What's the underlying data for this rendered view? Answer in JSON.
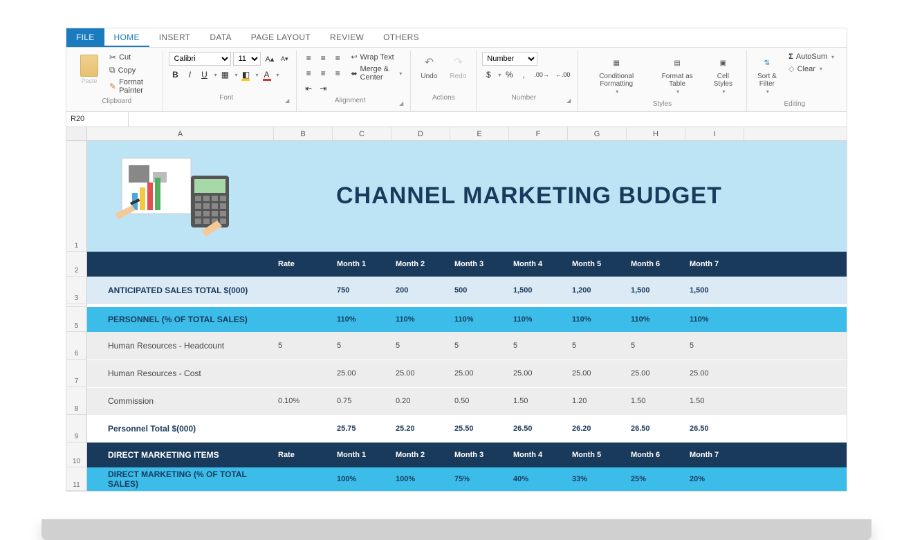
{
  "tabs": {
    "file": "FILE",
    "home": "HOME",
    "insert": "INSERT",
    "data": "DATA",
    "page_layout": "PAGE LAYOUT",
    "review": "REVIEW",
    "others": "OTHERS"
  },
  "ribbon": {
    "clipboard": {
      "label": "Clipboard",
      "cut": "Cut",
      "copy": "Copy",
      "format_painter": "Format Painter",
      "paste": "Paste"
    },
    "font": {
      "label": "Font",
      "family": "Calibri",
      "size": "11"
    },
    "alignment": {
      "label": "Alignment",
      "wrap": "Wrap Text",
      "merge": "Merge & Center"
    },
    "actions": {
      "label": "Actions",
      "undo": "Undo",
      "redo": "Redo"
    },
    "number": {
      "label": "Number",
      "format": "Number"
    },
    "styles": {
      "label": "Styles",
      "conditional": "Conditional Formatting",
      "format_as_table": "Format as Table",
      "cell_styles": "Cell Styles"
    },
    "editing": {
      "label": "Editing",
      "sort_filter": "Sort & Filter",
      "autosum": "AutoSum",
      "clear": "Clear"
    }
  },
  "name_box": "R20",
  "columns": [
    "A",
    "B",
    "C",
    "D",
    "E",
    "F",
    "G",
    "H",
    "I"
  ],
  "row_heights": {
    "banner": 160,
    "r2": 36,
    "r3": 40,
    "sep": 4,
    "r5": 36,
    "r6": 40,
    "r7": 40,
    "r8": 40,
    "r9": 40,
    "r10": 36,
    "r11": 34
  },
  "banner_title": "CHANNEL MARKETING BUDGET",
  "header_months": {
    "rate": "Rate",
    "m": [
      "Month 1",
      "Month 2",
      "Month 3",
      "Month 4",
      "Month 5",
      "Month 6",
      "Month 7"
    ]
  },
  "rows": {
    "anticipated": {
      "label": "ANTICIPATED SALES TOTAL $(000)",
      "rate": "",
      "v": [
        "750",
        "200",
        "500",
        "1,500",
        "1,200",
        "1,500",
        "1,500"
      ]
    },
    "personnel_pct": {
      "label": "PERSONNEL (% OF TOTAL SALES)",
      "rate": "",
      "v": [
        "110%",
        "110%",
        "110%",
        "110%",
        "110%",
        "110%",
        "110%"
      ]
    },
    "hr_headcount": {
      "label": "Human Resources - Headcount",
      "rate": "5",
      "v": [
        "5",
        "5",
        "5",
        "5",
        "5",
        "5",
        "5"
      ]
    },
    "hr_cost": {
      "label": "Human Resources - Cost",
      "rate": "",
      "v": [
        "25.00",
        "25.00",
        "25.00",
        "25.00",
        "25.00",
        "25.00",
        "25.00"
      ]
    },
    "commission": {
      "label": "Commission",
      "rate": "0.10%",
      "v": [
        "0.75",
        "0.20",
        "0.50",
        "1.50",
        "1.20",
        "1.50",
        "1.50"
      ]
    },
    "personnel_total": {
      "label": "Personnel Total $(000)",
      "rate": "",
      "v": [
        "25.75",
        "25.20",
        "25.50",
        "26.50",
        "26.20",
        "26.50",
        "26.50"
      ]
    },
    "direct_items": {
      "label": "DIRECT MARKETING ITEMS",
      "rate": "Rate",
      "v": [
        "Month 1",
        "Month 2",
        "Month 3",
        "Month 4",
        "Month 5",
        "Month 6",
        "Month 7"
      ]
    },
    "direct_pct": {
      "label": "DIRECT MARKETING (% OF TOTAL SALES)",
      "rate": "",
      "v": [
        "100%",
        "100%",
        "75%",
        "40%",
        "33%",
        "25%",
        "20%"
      ]
    }
  }
}
